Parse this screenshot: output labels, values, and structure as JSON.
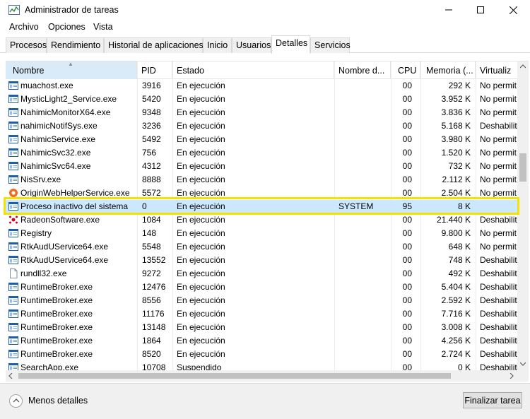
{
  "window": {
    "title": "Administrador de tareas"
  },
  "menu": [
    "Archivo",
    "Opciones",
    "Vista"
  ],
  "tabs": [
    "Procesos",
    "Rendimiento",
    "Historial de aplicaciones",
    "Inicio",
    "Usuarios",
    "Detalles",
    "Servicios"
  ],
  "active_tab": "Detalles",
  "columns": {
    "name": "Nombre",
    "pid": "PID",
    "state": "Estado",
    "user": "Nombre d...",
    "cpu": "CPU",
    "memory": "Memoria (...",
    "virt": "Virtualiz"
  },
  "rows": [
    {
      "icon": "window-icon",
      "name": "muachost.exe",
      "pid": "3916",
      "state": "En ejecución",
      "user": "",
      "cpu": "00",
      "mem": "292 K",
      "virt": "No permit"
    },
    {
      "icon": "window-icon",
      "name": "MysticLight2_Service.exe",
      "pid": "5420",
      "state": "En ejecución",
      "user": "",
      "cpu": "00",
      "mem": "3.952 K",
      "virt": "No permit"
    },
    {
      "icon": "window-icon",
      "name": "NahimicMonitorX64.exe",
      "pid": "9348",
      "state": "En ejecución",
      "user": "",
      "cpu": "00",
      "mem": "3.836 K",
      "virt": "No permit"
    },
    {
      "icon": "window-icon",
      "name": "nahimicNotifSys.exe",
      "pid": "3236",
      "state": "En ejecución",
      "user": "",
      "cpu": "00",
      "mem": "5.168 K",
      "virt": "Deshabilit"
    },
    {
      "icon": "window-icon",
      "name": "NahimicService.exe",
      "pid": "5492",
      "state": "En ejecución",
      "user": "",
      "cpu": "00",
      "mem": "3.980 K",
      "virt": "No permit"
    },
    {
      "icon": "window-icon",
      "name": "NahimicSvc32.exe",
      "pid": "756",
      "state": "En ejecución",
      "user": "",
      "cpu": "00",
      "mem": "1.520 K",
      "virt": "No permit"
    },
    {
      "icon": "window-icon",
      "name": "NahimicSvc64.exe",
      "pid": "4312",
      "state": "En ejecución",
      "user": "",
      "cpu": "00",
      "mem": "732 K",
      "virt": "No permit"
    },
    {
      "icon": "window-icon",
      "name": "NisSrv.exe",
      "pid": "8888",
      "state": "En ejecución",
      "user": "",
      "cpu": "00",
      "mem": "2.112 K",
      "virt": "No permit"
    },
    {
      "icon": "origin-icon",
      "name": "OriginWebHelperService.exe",
      "pid": "5572",
      "state": "En ejecución",
      "user": "",
      "cpu": "00",
      "mem": "2.504 K",
      "virt": "No permit"
    },
    {
      "icon": "window-icon",
      "name": "Proceso inactivo del sistema",
      "pid": "0",
      "state": "En ejecución",
      "user": "SYSTEM",
      "cpu": "95",
      "mem": "8 K",
      "virt": "",
      "selected": true
    },
    {
      "icon": "radeon-icon",
      "name": "RadeonSoftware.exe",
      "pid": "1084",
      "state": "En ejecución",
      "user": "",
      "cpu": "00",
      "mem": "21.440 K",
      "virt": "Deshabilit"
    },
    {
      "icon": "window-icon",
      "name": "Registry",
      "pid": "148",
      "state": "En ejecución",
      "user": "",
      "cpu": "00",
      "mem": "9.800 K",
      "virt": "No permit"
    },
    {
      "icon": "window-icon",
      "name": "RtkAudUService64.exe",
      "pid": "5548",
      "state": "En ejecución",
      "user": "",
      "cpu": "00",
      "mem": "648 K",
      "virt": "No permit"
    },
    {
      "icon": "window-icon",
      "name": "RtkAudUService64.exe",
      "pid": "13552",
      "state": "En ejecución",
      "user": "",
      "cpu": "00",
      "mem": "748 K",
      "virt": "Deshabilit"
    },
    {
      "icon": "file-icon",
      "name": "rundll32.exe",
      "pid": "9272",
      "state": "En ejecución",
      "user": "",
      "cpu": "00",
      "mem": "492 K",
      "virt": "Deshabilit"
    },
    {
      "icon": "window-icon",
      "name": "RuntimeBroker.exe",
      "pid": "12476",
      "state": "En ejecución",
      "user": "",
      "cpu": "00",
      "mem": "5.404 K",
      "virt": "Deshabilit"
    },
    {
      "icon": "window-icon",
      "name": "RuntimeBroker.exe",
      "pid": "8556",
      "state": "En ejecución",
      "user": "",
      "cpu": "00",
      "mem": "2.592 K",
      "virt": "Deshabilit"
    },
    {
      "icon": "window-icon",
      "name": "RuntimeBroker.exe",
      "pid": "11176",
      "state": "En ejecución",
      "user": "",
      "cpu": "00",
      "mem": "7.716 K",
      "virt": "Deshabilit"
    },
    {
      "icon": "window-icon",
      "name": "RuntimeBroker.exe",
      "pid": "13148",
      "state": "En ejecución",
      "user": "",
      "cpu": "00",
      "mem": "3.008 K",
      "virt": "Deshabilit"
    },
    {
      "icon": "window-icon",
      "name": "RuntimeBroker.exe",
      "pid": "1864",
      "state": "En ejecución",
      "user": "",
      "cpu": "00",
      "mem": "4.256 K",
      "virt": "Deshabilit"
    },
    {
      "icon": "window-icon",
      "name": "RuntimeBroker.exe",
      "pid": "8520",
      "state": "En ejecución",
      "user": "",
      "cpu": "00",
      "mem": "2.724 K",
      "virt": "Deshabilit"
    },
    {
      "icon": "window-icon",
      "name": "SearchApp.exe",
      "pid": "10708",
      "state": "Suspendido",
      "user": "",
      "cpu": "00",
      "mem": "0 K",
      "virt": "Deshabilit"
    }
  ],
  "footer": {
    "less_details": "Menos detalles",
    "end_task": "Finalizar tarea"
  },
  "colors": {
    "highlight": "#f2e300",
    "selected_row": "#cce8ff",
    "sorted_header": "#d9ebf9"
  }
}
